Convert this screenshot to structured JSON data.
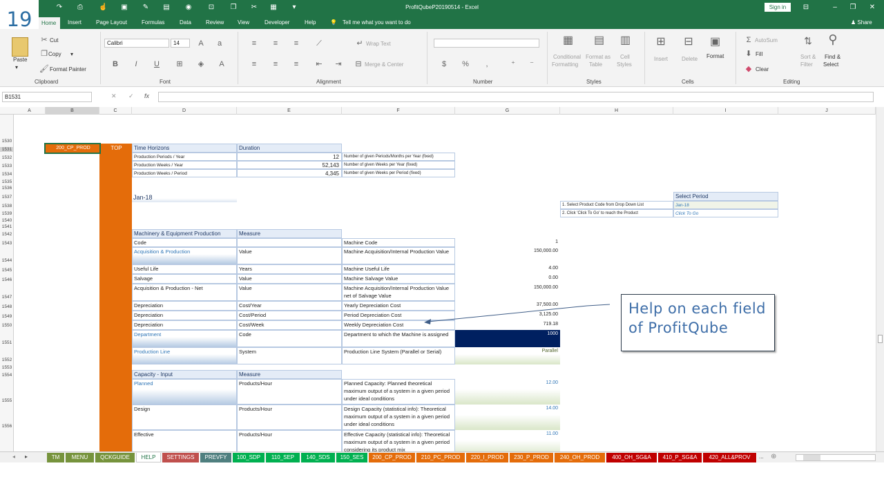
{
  "slide_number": "19",
  "window": {
    "title": "ProfitQubeP20190514  -  Excel",
    "sign_in": "Sign in",
    "share": "Share"
  },
  "ribbon_tabs": [
    "Home",
    "Insert",
    "Page Layout",
    "Formulas",
    "Data",
    "Review",
    "View",
    "Developer",
    "Help"
  ],
  "tell_me": "Tell me what you want to do",
  "clipboard": {
    "paste": "Paste",
    "cut": "Cut",
    "copy": "Copy",
    "format_painter": "Format Painter",
    "label": "Clipboard"
  },
  "font": {
    "name": "Calibri",
    "size": "14",
    "label": "Font"
  },
  "alignment": {
    "wrap": "Wrap Text",
    "merge": "Merge & Center",
    "label": "Alignment"
  },
  "number": {
    "label": "Number"
  },
  "styles": {
    "conditional": "Conditional",
    "formatting": "Formatting",
    "format_as": "Format as",
    "table": "Table",
    "cell": "Cell",
    "cell_styles": "Styles",
    "label": "Styles"
  },
  "cells": {
    "insert": "Insert",
    "delete": "Delete",
    "format": "Format",
    "label": "Cells"
  },
  "editing": {
    "autosum": "AutoSum",
    "fill": "Fill",
    "clear": "Clear",
    "sort": "Sort &",
    "filter": "Filter",
    "find": "Find &",
    "select": "Select",
    "label": "Editing"
  },
  "formula_bar": {
    "name_box": "B1531",
    "value": ""
  },
  "columns": [
    "A",
    "B",
    "C",
    "D",
    "E",
    "F",
    "G",
    "H",
    "I",
    "J"
  ],
  "rows": [
    "1530",
    "1531",
    "1532",
    "1533",
    "1534",
    "1535",
    "1536",
    "1537",
    "1538",
    "1539",
    "1540",
    "1541",
    "1542",
    "1543",
    "1544",
    "1545",
    "1546",
    "1547",
    "1548",
    "1549",
    "1550",
    "1551",
    "1552",
    "1553",
    "1554",
    "1555",
    "1556"
  ],
  "cells_data": {
    "b1531": "200_CP_PROD",
    "c1531": "TOP",
    "time_horizons": "Time Horizons",
    "duration": "Duration",
    "th_rows": [
      {
        "label": "Production Periods / Year",
        "value": "12",
        "desc": "Number of given Periods/Months per Year (fixed)"
      },
      {
        "label": "Production Weeks / Year",
        "value": "52,143",
        "desc": "Number of given Weeks per Year (fixed)"
      },
      {
        "label": "Production Weeks / Period",
        "value": "4,345",
        "desc": "Number of given Weeks per Period (fixed)"
      }
    ],
    "period": "Jan-18",
    "select_period": "Select Period",
    "sp_rows": [
      {
        "label": "1. Select Product Code from Drop Down List",
        "value": "Jan-18"
      },
      {
        "label": "2. Click 'Click To Go' to reach the Product",
        "value": "Click To Go"
      }
    ],
    "mach_title": "Machinery & Equipment Production",
    "measure": "Measure",
    "mach_rows": [
      {
        "a": "Code",
        "b": "",
        "c": "Machine Code",
        "d": "1"
      },
      {
        "a": "Acquisition & Production",
        "b": "Value",
        "c": "Machine Acquisition/Internal Production Value",
        "d": "150,000.00"
      },
      {
        "a": "Useful Life",
        "b": "Years",
        "c": "Machine Useful Life",
        "d": "4.00"
      },
      {
        "a": "Salvage",
        "b": "Value",
        "c": "Machine Salvage Value",
        "d": "0.00"
      },
      {
        "a": "Acquisition & Production - Net",
        "b": "Value",
        "c": "Machine Acquisition/Internal Production Value net of Salvage Value",
        "d": "150,000.00"
      },
      {
        "a": "Depreciation",
        "b": "Cost/Year",
        "c": "Yearly Depreciation Cost",
        "d": "37,500.00"
      },
      {
        "a": "Depreciation",
        "b": "Cost/Period",
        "c": "Period Depreciation Cost",
        "d": "3,125.00"
      },
      {
        "a": "Depreciation",
        "b": "Cost/Week",
        "c": "Weekly Depreciation Cost",
        "d": "719.18"
      },
      {
        "a": "Department",
        "b": "Code",
        "c": "Department to which the Machine is assigned",
        "d": "1000"
      },
      {
        "a": "Production Line",
        "b": "System",
        "c": "Production Line System (Parallel or Serial)",
        "d": "Parallel"
      }
    ],
    "cap_title": "Capacity - Input",
    "cap_measure": "Measure",
    "cap_rows": [
      {
        "a": "Planned",
        "b": "Products/Hour",
        "c": "Planned Capacity: Planned theoretical maximum output of a system in a given period under ideal conditions",
        "d": "12.00"
      },
      {
        "a": "Design",
        "b": "Products/Hour",
        "c": "Design Capacity (statistical info): Theoretical maximum output of a system in a given period under ideal conditions",
        "d": "14.00"
      },
      {
        "a": "Effective",
        "b": "Products/Hour",
        "c": "Effective Capacity (statistical info): Theoretical maximum output of a system in a given period considering its product mix",
        "d": "11.00"
      }
    ]
  },
  "callout": "Help on each field of ProfitQube",
  "sheet_tabs": [
    {
      "name": "TM",
      "color": "#76933c"
    },
    {
      "name": "MENU",
      "color": "#76933c"
    },
    {
      "name": "QCKGUIDE",
      "color": "#76933c"
    },
    {
      "name": "HELP",
      "color": "#ffffff"
    },
    {
      "name": "SETTINGS",
      "color": "#c0504d"
    },
    {
      "name": "PREVFY",
      "color": "#4f7f7f"
    },
    {
      "name": "100_SDP",
      "color": "#00b050"
    },
    {
      "name": "110_SEP",
      "color": "#00b050"
    },
    {
      "name": "140_SDS",
      "color": "#00b050"
    },
    {
      "name": "150_SES",
      "color": "#00b050"
    },
    {
      "name": "200_CP_PROD",
      "color": "#e46c0a"
    },
    {
      "name": "210_PC_PROD",
      "color": "#e46c0a"
    },
    {
      "name": "220_I_PROD",
      "color": "#e46c0a"
    },
    {
      "name": "230_P_PROD",
      "color": "#e46c0a"
    },
    {
      "name": "240_OH_PROD",
      "color": "#e46c0a"
    },
    {
      "name": "400_OH_SG&A",
      "color": "#c00000"
    },
    {
      "name": "410_P_SG&A",
      "color": "#c00000"
    },
    {
      "name": "420_ALL&PROV",
      "color": "#c00000"
    }
  ],
  "more_tabs": "...",
  "colors": {
    "excel_green": "#217346",
    "orange": "#e46c0a",
    "navy": "#002060"
  }
}
